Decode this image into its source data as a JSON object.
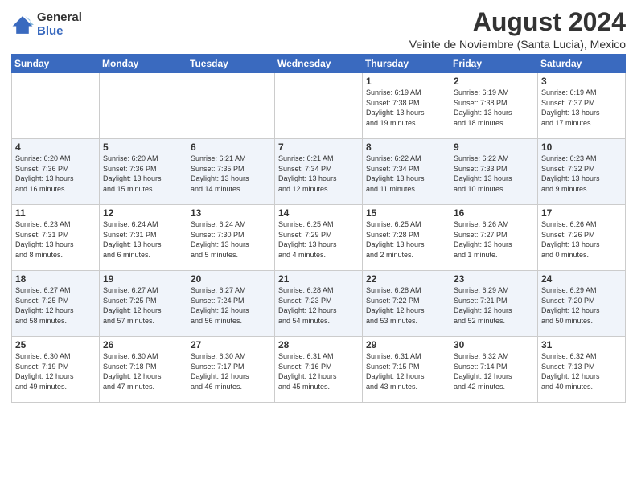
{
  "logo": {
    "general": "General",
    "blue": "Blue"
  },
  "title": "August 2024",
  "subtitle": "Veinte de Noviembre (Santa Lucia), Mexico",
  "weekdays": [
    "Sunday",
    "Monday",
    "Tuesday",
    "Wednesday",
    "Thursday",
    "Friday",
    "Saturday"
  ],
  "weeks": [
    [
      {
        "day": "",
        "info": ""
      },
      {
        "day": "",
        "info": ""
      },
      {
        "day": "",
        "info": ""
      },
      {
        "day": "",
        "info": ""
      },
      {
        "day": "1",
        "info": "Sunrise: 6:19 AM\nSunset: 7:38 PM\nDaylight: 13 hours\nand 19 minutes."
      },
      {
        "day": "2",
        "info": "Sunrise: 6:19 AM\nSunset: 7:38 PM\nDaylight: 13 hours\nand 18 minutes."
      },
      {
        "day": "3",
        "info": "Sunrise: 6:19 AM\nSunset: 7:37 PM\nDaylight: 13 hours\nand 17 minutes."
      }
    ],
    [
      {
        "day": "4",
        "info": "Sunrise: 6:20 AM\nSunset: 7:36 PM\nDaylight: 13 hours\nand 16 minutes."
      },
      {
        "day": "5",
        "info": "Sunrise: 6:20 AM\nSunset: 7:36 PM\nDaylight: 13 hours\nand 15 minutes."
      },
      {
        "day": "6",
        "info": "Sunrise: 6:21 AM\nSunset: 7:35 PM\nDaylight: 13 hours\nand 14 minutes."
      },
      {
        "day": "7",
        "info": "Sunrise: 6:21 AM\nSunset: 7:34 PM\nDaylight: 13 hours\nand 12 minutes."
      },
      {
        "day": "8",
        "info": "Sunrise: 6:22 AM\nSunset: 7:34 PM\nDaylight: 13 hours\nand 11 minutes."
      },
      {
        "day": "9",
        "info": "Sunrise: 6:22 AM\nSunset: 7:33 PM\nDaylight: 13 hours\nand 10 minutes."
      },
      {
        "day": "10",
        "info": "Sunrise: 6:23 AM\nSunset: 7:32 PM\nDaylight: 13 hours\nand 9 minutes."
      }
    ],
    [
      {
        "day": "11",
        "info": "Sunrise: 6:23 AM\nSunset: 7:31 PM\nDaylight: 13 hours\nand 8 minutes."
      },
      {
        "day": "12",
        "info": "Sunrise: 6:24 AM\nSunset: 7:31 PM\nDaylight: 13 hours\nand 6 minutes."
      },
      {
        "day": "13",
        "info": "Sunrise: 6:24 AM\nSunset: 7:30 PM\nDaylight: 13 hours\nand 5 minutes."
      },
      {
        "day": "14",
        "info": "Sunrise: 6:25 AM\nSunset: 7:29 PM\nDaylight: 13 hours\nand 4 minutes."
      },
      {
        "day": "15",
        "info": "Sunrise: 6:25 AM\nSunset: 7:28 PM\nDaylight: 13 hours\nand 2 minutes."
      },
      {
        "day": "16",
        "info": "Sunrise: 6:26 AM\nSunset: 7:27 PM\nDaylight: 13 hours\nand 1 minute."
      },
      {
        "day": "17",
        "info": "Sunrise: 6:26 AM\nSunset: 7:26 PM\nDaylight: 13 hours\nand 0 minutes."
      }
    ],
    [
      {
        "day": "18",
        "info": "Sunrise: 6:27 AM\nSunset: 7:25 PM\nDaylight: 12 hours\nand 58 minutes."
      },
      {
        "day": "19",
        "info": "Sunrise: 6:27 AM\nSunset: 7:25 PM\nDaylight: 12 hours\nand 57 minutes."
      },
      {
        "day": "20",
        "info": "Sunrise: 6:27 AM\nSunset: 7:24 PM\nDaylight: 12 hours\nand 56 minutes."
      },
      {
        "day": "21",
        "info": "Sunrise: 6:28 AM\nSunset: 7:23 PM\nDaylight: 12 hours\nand 54 minutes."
      },
      {
        "day": "22",
        "info": "Sunrise: 6:28 AM\nSunset: 7:22 PM\nDaylight: 12 hours\nand 53 minutes."
      },
      {
        "day": "23",
        "info": "Sunrise: 6:29 AM\nSunset: 7:21 PM\nDaylight: 12 hours\nand 52 minutes."
      },
      {
        "day": "24",
        "info": "Sunrise: 6:29 AM\nSunset: 7:20 PM\nDaylight: 12 hours\nand 50 minutes."
      }
    ],
    [
      {
        "day": "25",
        "info": "Sunrise: 6:30 AM\nSunset: 7:19 PM\nDaylight: 12 hours\nand 49 minutes."
      },
      {
        "day": "26",
        "info": "Sunrise: 6:30 AM\nSunset: 7:18 PM\nDaylight: 12 hours\nand 47 minutes."
      },
      {
        "day": "27",
        "info": "Sunrise: 6:30 AM\nSunset: 7:17 PM\nDaylight: 12 hours\nand 46 minutes."
      },
      {
        "day": "28",
        "info": "Sunrise: 6:31 AM\nSunset: 7:16 PM\nDaylight: 12 hours\nand 45 minutes."
      },
      {
        "day": "29",
        "info": "Sunrise: 6:31 AM\nSunset: 7:15 PM\nDaylight: 12 hours\nand 43 minutes."
      },
      {
        "day": "30",
        "info": "Sunrise: 6:32 AM\nSunset: 7:14 PM\nDaylight: 12 hours\nand 42 minutes."
      },
      {
        "day": "31",
        "info": "Sunrise: 6:32 AM\nSunset: 7:13 PM\nDaylight: 12 hours\nand 40 minutes."
      }
    ]
  ]
}
